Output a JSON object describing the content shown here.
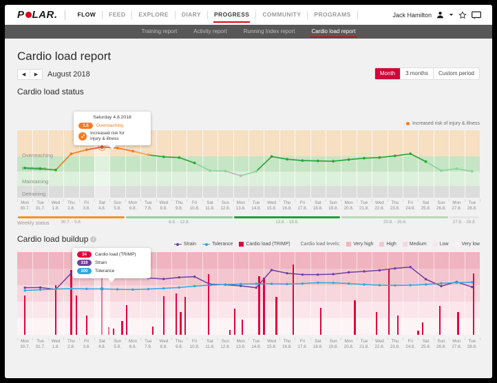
{
  "header": {
    "logo_text_left": "P",
    "logo_text_right": "LAR.",
    "flow_label": "FLOW",
    "nav": [
      {
        "label": "FEED",
        "active": false
      },
      {
        "label": "EXPLORE",
        "active": false
      },
      {
        "label": "DIARY",
        "active": false
      },
      {
        "label": "PROGRESS",
        "active": true
      },
      {
        "label": "COMMUNITY",
        "active": false
      },
      {
        "label": "PROGRAMS",
        "active": false
      }
    ],
    "user_name": "Jack Hamilton",
    "icons": [
      "user-icon",
      "chevron-down-icon",
      "star-icon",
      "chat-icon"
    ]
  },
  "subnav": {
    "tabs": [
      {
        "label": "Training report",
        "active": false
      },
      {
        "label": "Activity report",
        "active": false
      },
      {
        "label": "Running Index report",
        "active": false
      },
      {
        "label": "Cardio load report",
        "active": true
      }
    ]
  },
  "page": {
    "title": "Cardio load report",
    "month": "August 2018",
    "prev_arrow": "◀",
    "next_arrow": "▶",
    "period_buttons": [
      {
        "label": "Month",
        "active": true
      },
      {
        "label": "3 months",
        "active": false
      },
      {
        "label": "Custom period",
        "active": false
      }
    ],
    "section1_title": "Cardio load status",
    "section2_title": "Cardio load buildup",
    "risk_legend": "Increased risk of injury & illness",
    "weekly_status_label": "Weekly status"
  },
  "tooltip_status": {
    "date": "Saturday 4.8.2018",
    "value": "1.5",
    "value_label": "Overreaching",
    "risk_line1": "Increased risk for",
    "risk_line2": "injury & illness",
    "icon": "injury-risk-icon"
  },
  "tooltip_buildup": {
    "rows": [
      {
        "value": "34",
        "label": "Cardio load (TRIMP)",
        "color": "#e2003c"
      },
      {
        "value": "319",
        "label": "Strain",
        "color": "#6b3fa0"
      },
      {
        "value": "200",
        "label": "Tolerance",
        "color": "#29a8e0"
      }
    ]
  },
  "legend_buildup": {
    "items": [
      {
        "label": "Strain",
        "color": "#6b3fa0",
        "type": "line"
      },
      {
        "label": "Tolerance",
        "color": "#29a8e0",
        "type": "line"
      },
      {
        "label": "Cardio load (TRIMP)",
        "color": "#e2003c",
        "type": "square"
      }
    ],
    "levels_label": "Cardio load levels:",
    "levels": [
      {
        "label": "Very high",
        "color": "#f0b7c2"
      },
      {
        "label": "High",
        "color": "#f4c6cf"
      },
      {
        "label": "Medium",
        "color": "#f8d6dd"
      },
      {
        "label": "Low",
        "color": "#fbe6ea"
      },
      {
        "label": "Very low",
        "color": "#fdf2f4"
      }
    ]
  },
  "chart_data": [
    {
      "type": "line",
      "title": "Cardio load status",
      "xlabel": "",
      "ylabel": "Cardio load status",
      "grid": true,
      "zones": [
        {
          "label": "Overreaching",
          "color": "#f7dfc2"
        },
        {
          "label": "Productive",
          "color": "#c6e5c4"
        },
        {
          "label": "Maintaining",
          "color": "#ddf0dc"
        },
        {
          "label": "Detraining",
          "color": "#dcdcdc"
        }
      ],
      "categories": [
        "Mon 30.7.",
        "Tue 31.7.",
        "Wed 1.8.",
        "Thu 2.8.",
        "Fri 3.8.",
        "Sat 4.8.",
        "Sun 5.8.",
        "Mon 6.8.",
        "Tue 7.8.",
        "Wed 8.8.",
        "Thu 9.8.",
        "Fri 10.8.",
        "Sat 11.8.",
        "Sun 12.8.",
        "Mon 13.8.",
        "Tue 14.8.",
        "Wed 15.8.",
        "Thu 16.8.",
        "Fri 17.8.",
        "Sat 18.8.",
        "Sun 19.8.",
        "Mon 20.8.",
        "Tue 21.8.",
        "Wed 22.8.",
        "Thu 23.8.",
        "Fri 24.8.",
        "Sat 25.8.",
        "Sun 26.8.",
        "Mon 27.8.",
        "Tue 28.8."
      ],
      "day_labels": [
        [
          "Mon",
          "30.7."
        ],
        [
          "Tue",
          "31.7."
        ],
        [
          "Wed",
          "1.8."
        ],
        [
          "Thu",
          "2.8."
        ],
        [
          "Fri",
          "3.8."
        ],
        [
          "Sat",
          "4.8."
        ],
        [
          "Sun",
          "5.8."
        ],
        [
          "Mon",
          "6.8."
        ],
        [
          "Tue",
          "7.8."
        ],
        [
          "Wed",
          "8.8."
        ],
        [
          "Thu",
          "9.8."
        ],
        [
          "Fri",
          "10.8."
        ],
        [
          "Sat",
          "11.8."
        ],
        [
          "Sun",
          "12.8."
        ],
        [
          "Mon",
          "13.8."
        ],
        [
          "Tue",
          "14.8."
        ],
        [
          "Wed",
          "15.8."
        ],
        [
          "Thu",
          "16.8."
        ],
        [
          "Fri",
          "17.8."
        ],
        [
          "Sat",
          "18.8."
        ],
        [
          "Sun",
          "19.8."
        ],
        [
          "Mon",
          "20.8."
        ],
        [
          "Tue",
          "21.8."
        ],
        [
          "Wed",
          "22.8."
        ],
        [
          "Thu",
          "23.8."
        ],
        [
          "Fri",
          "24.8."
        ],
        [
          "Sat",
          "25.8."
        ],
        [
          "Sun",
          "26.8."
        ],
        [
          "Mon",
          "27.8."
        ],
        [
          "Tue",
          "28.8."
        ]
      ],
      "values": [
        0.88,
        0.86,
        0.82,
        1.3,
        1.42,
        1.5,
        1.47,
        1.38,
        1.27,
        1.21,
        1.19,
        1.03,
        0.8,
        0.79,
        0.65,
        0.78,
        1.22,
        1.14,
        1.1,
        1.09,
        1.08,
        1.13,
        1.17,
        1.19,
        1.24,
        1.3,
        1.07,
        0.8,
        0.86,
        0.78
      ],
      "point_colors": [
        "#2aa63a",
        "#2aa63a",
        "#2aa63a",
        "#f47b20",
        "#f47b20",
        "#f05a28",
        "#f47b20",
        "#f47b20",
        "#f6a04a",
        "#2aa63a",
        "#2aa63a",
        "#2aa63a",
        "#8cd49b",
        "#8cd49b",
        "#b9b9b9",
        "#8cd49b",
        "#2aa63a",
        "#2aa63a",
        "#2aa63a",
        "#2aa63a",
        "#2aa63a",
        "#2aa63a",
        "#2aa63a",
        "#2aa63a",
        "#2aa63a",
        "#2aa63a",
        "#2aa63a",
        "#8cd49b",
        "#8cd49b",
        "#8cd49b"
      ],
      "highlight_index": 5,
      "ylim": [
        0,
        2
      ]
    },
    {
      "type": "bar",
      "title": "Cardio load buildup",
      "xlabel": "",
      "ylabel": "Cardio load (TRIMP)",
      "grid": true,
      "categories": [
        "Mon 30.7.",
        "Tue 31.7.",
        "Wed 1.8.",
        "Thu 2.8.",
        "Fri 3.8.",
        "Sat 4.8.",
        "Sun 5.8.",
        "Mon 6.8.",
        "Tue 7.8.",
        "Wed 8.8.",
        "Thu 9.8.",
        "Fri 10.8.",
        "Sat 11.8.",
        "Sun 12.8.",
        "Mon 13.8.",
        "Tue 14.8.",
        "Wed 15.8.",
        "Thu 16.8.",
        "Fri 17.8.",
        "Sat 18.8.",
        "Sun 19.8.",
        "Mon 20.8.",
        "Tue 21.8.",
        "Wed 22.8.",
        "Thu 23.8.",
        "Fri 24.8.",
        "Sat 25.8.",
        "Sun 26.8.",
        "Mon 27.8.",
        "Tue 28.8."
      ],
      "day_labels": [
        [
          "Mon",
          "30.7."
        ],
        [
          "Tue",
          "31.7."
        ],
        [
          "Wed",
          "1.8."
        ],
        [
          "Thu",
          "2.8."
        ],
        [
          "Fri",
          "3.8."
        ],
        [
          "Sat",
          "4.8."
        ],
        [
          "Sun",
          "5.8."
        ],
        [
          "Mon",
          "6.8."
        ],
        [
          "Tue",
          "7.8."
        ],
        [
          "Wed",
          "8.8."
        ],
        [
          "Thu",
          "9.8."
        ],
        [
          "Fri",
          "10.8."
        ],
        [
          "Sat",
          "11.8."
        ],
        [
          "Sun",
          "12.8."
        ],
        [
          "Mon",
          "13.8."
        ],
        [
          "Tue",
          "14.8."
        ],
        [
          "Wed",
          "15.8."
        ],
        [
          "Thu",
          "16.8."
        ],
        [
          "Fri",
          "17.8."
        ],
        [
          "Sat",
          "18.8."
        ],
        [
          "Sun",
          "19.8."
        ],
        [
          "Mon",
          "20.8."
        ],
        [
          "Tue",
          "21.8."
        ],
        [
          "Wed",
          "22.8."
        ],
        [
          "Thu",
          "23.8."
        ],
        [
          "Fri",
          "24.8."
        ],
        [
          "Sat",
          "25.8."
        ],
        [
          "Sun",
          "26.8."
        ],
        [
          "Mon",
          "27.8."
        ],
        [
          "Tue",
          "28.8."
        ]
      ],
      "bars": [
        {
          "i": 0,
          "v": 62
        },
        {
          "i": 2,
          "v": 78
        },
        {
          "i": 3,
          "v": 102
        },
        {
          "i": 3.35,
          "v": 62
        },
        {
          "i": 4,
          "v": 30
        },
        {
          "i": 5,
          "v": 100
        },
        {
          "i": 5.45,
          "v": 12
        },
        {
          "i": 5.75,
          "v": 10
        },
        {
          "i": 6.3,
          "v": 22
        },
        {
          "i": 6.6,
          "v": 47
        },
        {
          "i": 8.3,
          "v": 13
        },
        {
          "i": 9,
          "v": 61
        },
        {
          "i": 9.8,
          "v": 65
        },
        {
          "i": 10.1,
          "v": 36
        },
        {
          "i": 10.4,
          "v": 60
        },
        {
          "i": 11.9,
          "v": 95
        },
        {
          "i": 13.3,
          "v": 8
        },
        {
          "i": 13.6,
          "v": 41
        },
        {
          "i": 14.1,
          "v": 24
        },
        {
          "i": 15.2,
          "v": 92
        },
        {
          "i": 15.5,
          "v": 90
        },
        {
          "i": 16.3,
          "v": 60
        },
        {
          "i": 17.4,
          "v": 110
        },
        {
          "i": 19.2,
          "v": 42
        },
        {
          "i": 21.4,
          "v": 54
        },
        {
          "i": 22.8,
          "v": 36
        },
        {
          "i": 23.6,
          "v": 103
        },
        {
          "i": 24.2,
          "v": 30
        },
        {
          "i": 25.5,
          "v": 6
        },
        {
          "i": 25.8,
          "v": 20
        },
        {
          "i": 26.9,
          "v": 46
        },
        {
          "i": 28.1,
          "v": 36
        },
        {
          "i": 29.1,
          "v": 96
        },
        {
          "i": 29.6,
          "v": 104
        }
      ],
      "series": [
        {
          "name": "Strain",
          "color": "#6b3fa0",
          "values": [
            205,
            206,
            198,
            268,
            290,
            319,
            300,
            272,
            247,
            243,
            250,
            253,
            220,
            218,
            213,
            205,
            282,
            268,
            262,
            262,
            264,
            272,
            276,
            281,
            289,
            295,
            242,
            212,
            230,
            208
          ]
        },
        {
          "name": "Tolerance",
          "color": "#29a8e0",
          "values": [
            193,
            196,
            199,
            201,
            200,
            200,
            198,
            197,
            199,
            202,
            206,
            212,
            216,
            219,
            221,
            222,
            222,
            221,
            223,
            227,
            226,
            223,
            219,
            216,
            215,
            216,
            219,
            224,
            227,
            229
          ]
        }
      ],
      "levels": [
        {
          "label": "Very high",
          "color": "#efb4c0"
        },
        {
          "label": "High",
          "color": "#f3c5ce"
        },
        {
          "label": "Medium",
          "color": "#f7d6dd"
        },
        {
          "label": "Low",
          "color": "#fbe7eb"
        },
        {
          "label": "Very low",
          "color": "#fdf4f6"
        }
      ],
      "highlight_index": 5,
      "ylim": [
        0,
        130
      ]
    }
  ],
  "weekly_status": {
    "bars": [
      {
        "start": 0,
        "end": 7,
        "color": "#f59220",
        "label": "30.7. - 5.8."
      },
      {
        "start": 7,
        "end": 14,
        "color": "#8cd49b",
        "label": "6.8. - 12.8."
      },
      {
        "start": 14,
        "end": 21,
        "color": "#16a52e",
        "label": "13.8. - 19.8."
      },
      {
        "start": 21,
        "end": 28,
        "color": "#a9e2b5",
        "label": "20.8. - 26.8."
      },
      {
        "start": 28,
        "end": 30,
        "color": "#e4e4e4",
        "label": "27.8. - 28.8."
      }
    ]
  }
}
